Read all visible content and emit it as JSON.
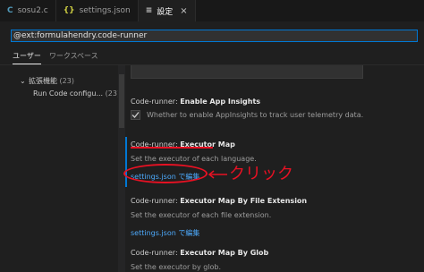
{
  "tabs": [
    {
      "icon": "c-file-icon",
      "glyph": "C",
      "label": "sosu2.c"
    },
    {
      "icon": "json-file-icon",
      "glyph": "{}",
      "label": "settings.json"
    },
    {
      "icon": "settings-icon",
      "glyph": "≡",
      "label": "設定",
      "close": "×"
    }
  ],
  "search": {
    "value": "@ext:formulahendry.code-runner"
  },
  "scope_tabs": [
    "ユーザー",
    "ワークスペース"
  ],
  "toc": {
    "group_label": "拡張機能",
    "group_count": "(23)",
    "item_label": "Run Code configu...",
    "item_count": "(23)"
  },
  "settings": [
    {
      "prefix": "Code-runner: ",
      "name": "Enable App Insights",
      "desc": "Whether to enable AppInsights to track user telemetry data.",
      "checked": true
    },
    {
      "prefix": "Code-runner: ",
      "name": "Executor Map",
      "desc": "Set the executor of each language.",
      "link": "settings.json で編集"
    },
    {
      "prefix": "Code-runner: ",
      "name": "Executor Map By File Extension",
      "desc": "Set the executor of each file extension.",
      "link": "settings.json で編集"
    },
    {
      "prefix": "Code-runner: ",
      "name": "Executor Map By Glob",
      "desc": "Set the executor by glob."
    }
  ],
  "annotation": {
    "label": "クリック",
    "color": "#e81123"
  },
  "colors": {
    "accent": "#0078d4",
    "link": "#4daafc",
    "background": "#1f1f1f"
  }
}
